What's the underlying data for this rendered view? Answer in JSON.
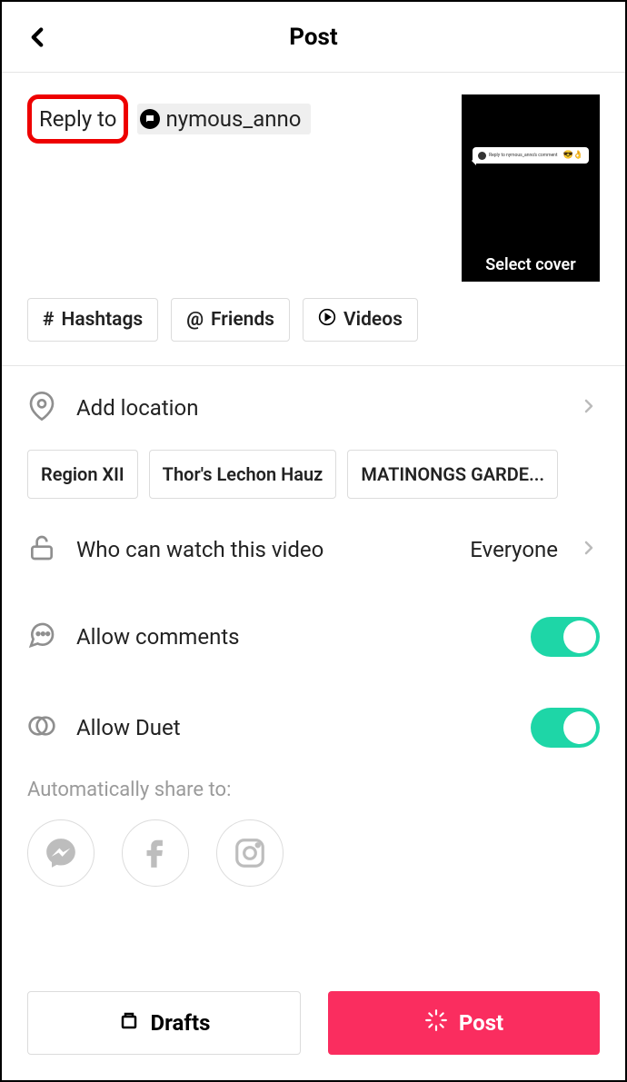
{
  "header": {
    "title": "Post"
  },
  "compose": {
    "reply_label": "Reply to",
    "mention": "nymous_anno",
    "select_cover": "Select cover",
    "thumb_text": "Reply to nymous_anno's comment"
  },
  "chips": {
    "hashtags": "Hashtags",
    "friends": "Friends",
    "videos": "Videos"
  },
  "settings": {
    "add_location": "Add location",
    "locations": [
      "Region XII",
      "Thor's Lechon Hauz",
      "MATINONGS GARDE..."
    ],
    "privacy_label": "Who can watch this video",
    "privacy_value": "Everyone",
    "allow_comments": "Allow comments",
    "allow_duet": "Allow Duet"
  },
  "share": {
    "label": "Automatically share to:"
  },
  "buttons": {
    "drafts": "Drafts",
    "post": "Post"
  }
}
